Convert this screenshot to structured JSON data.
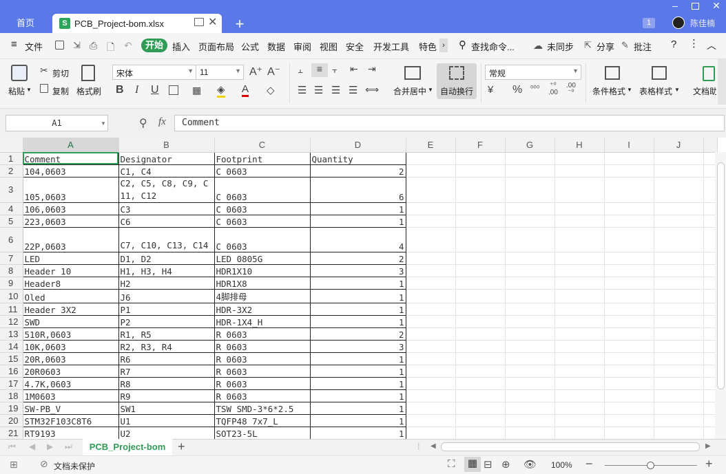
{
  "titlebar": {
    "home_tab": "首页",
    "file_tab": "PCB_Project-bom.xlsx",
    "file_icon_letter": "S",
    "badge": "1",
    "user": "陈佳楠",
    "new_tab": "+"
  },
  "menu": {
    "file": "文件",
    "start": "开始",
    "items": [
      "插入",
      "页面布局",
      "公式",
      "数据",
      "审阅",
      "视图",
      "安全",
      "开发工具",
      "特色"
    ],
    "search": "查找命令...",
    "sync": "未同步",
    "share": "分享",
    "comment": "批注",
    "help": "?"
  },
  "ribbon": {
    "paste": "粘贴",
    "cut": "剪切",
    "copy": "复制",
    "format_painter": "格式刷",
    "font_name": "宋体",
    "font_size": "11",
    "bold": "B",
    "italic": "I",
    "underline": "U",
    "merge_center": "合并居中",
    "auto_wrap": "自动换行",
    "number_format": "常规",
    "percent": "%",
    "cond_format": "条件格式",
    "table_style": "表格样式",
    "doc_assist": "文档助"
  },
  "formula": {
    "cell_ref": "A1",
    "fx": "fx",
    "content": "Comment"
  },
  "grid": {
    "columns": [
      "A",
      "B",
      "C",
      "D",
      "E",
      "F",
      "G",
      "H",
      "I",
      "J"
    ],
    "header": [
      "Comment",
      "Designator",
      "Footprint",
      "Quantity"
    ],
    "rows": [
      [
        "104,0603",
        "C1, C4",
        "C 0603",
        "2"
      ],
      [
        "105,0603",
        "C2, C5, C8, C9, C11, C12",
        "C 0603",
        "6"
      ],
      [
        "106,0603",
        "C3",
        "C 0603",
        "1"
      ],
      [
        "223,0603",
        "C6",
        "C 0603",
        "1"
      ],
      [
        "22P,0603",
        "C7, C10, C13, C14",
        "C 0603",
        "4"
      ],
      [
        "LED",
        "D1, D2",
        "LED 0805G",
        "2"
      ],
      [
        "Header 10",
        "H1, H3, H4",
        "HDR1X10",
        "3"
      ],
      [
        "Header8",
        "H2",
        "HDR1X8",
        "1"
      ],
      [
        "Oled",
        "J6",
        "4脚排母",
        "1"
      ],
      [
        "Header 3X2",
        "P1",
        "HDR-3X2",
        "1"
      ],
      [
        "SWD",
        "P2",
        "HDR-1X4_H",
        "1"
      ],
      [
        "510R,0603",
        "R1, R5",
        "R 0603",
        "2"
      ],
      [
        "10K,0603",
        "R2, R3, R4",
        "R 0603",
        "3"
      ],
      [
        "20R,0603",
        "R6",
        "R 0603",
        "1"
      ],
      [
        "20R0603",
        "R7",
        "R 0603",
        "1"
      ],
      [
        "4.7K,0603",
        "R8",
        "R 0603",
        "1"
      ],
      [
        "1M0603",
        "R9",
        "R 0603",
        "1"
      ],
      [
        "SW-PB_V",
        "SW1",
        "TSW SMD-3*6*2.5",
        "1"
      ],
      [
        "STM32F103C8T6",
        "U1",
        "TQFP48 7x7_L",
        "1"
      ],
      [
        "RT9193",
        "U2",
        "SOT23-5L",
        "1"
      ]
    ]
  },
  "sheets": {
    "active": "PCB_Project-bom",
    "add": "+"
  },
  "status": {
    "protect": "文档未保护",
    "zoom": "100%",
    "zoom_level": 0.5
  }
}
